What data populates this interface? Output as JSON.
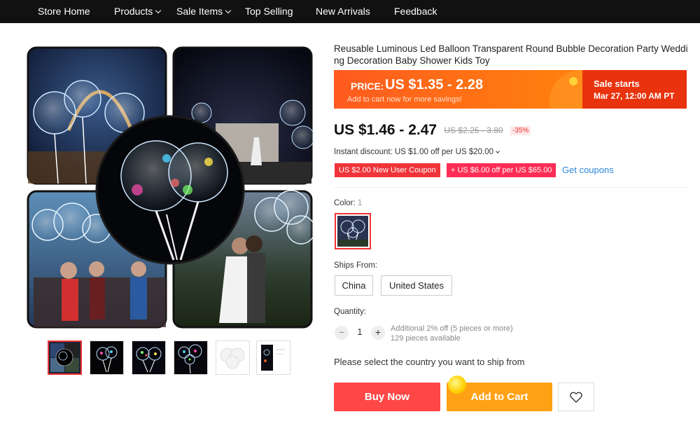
{
  "nav": {
    "items": [
      {
        "label": "Store Home"
      },
      {
        "label": "Products"
      },
      {
        "label": "Sale Items"
      },
      {
        "label": "Top Selling"
      },
      {
        "label": "New Arrivals"
      },
      {
        "label": "Feedback"
      }
    ]
  },
  "product": {
    "title_line1": "Reusable Luminous Led Balloon Transparent Round Bubble Decoration Party Weddi",
    "title_line2": "ng Decoration Baby Shower Kids Toy"
  },
  "banner": {
    "price_label": "PRICE:",
    "price_value": "US $1.35 - 2.28",
    "sub": "Add to cart now for more savings!",
    "sale_title": "Sale starts",
    "sale_date": "Mar 27, 12:00 AM PT"
  },
  "price": {
    "current": "US $1.46 - 2.47",
    "original": "US $2.25 - 3.80",
    "discount": "-35%"
  },
  "instant_discount": "Instant discount: US $1.00 off per US $20.00",
  "coupons": {
    "new_user": "US $2.00 New User Coupon",
    "store": "+ US $6.00 off per US $65.00",
    "get_link": "Get coupons"
  },
  "color": {
    "label": "Color:",
    "selected_count": "1"
  },
  "ships_from": {
    "label": "Ships From:",
    "options": [
      "China",
      "United States"
    ]
  },
  "quantity": {
    "label": "Quantity:",
    "minus": "−",
    "value": "1",
    "plus": "+",
    "note_line1": "Additional 2% off (5 pieces or more)",
    "note_line2": "129 pieces available"
  },
  "ship_notice": "Please select the country you want to ship from",
  "actions": {
    "buy_now": "Buy Now",
    "add_to_cart": "Add to Cart"
  },
  "colors": {
    "nav_bg": "#111111",
    "accent_red": "#ff4747",
    "accent_orange": "#ffa114",
    "banner_orange": "#ff6a14",
    "coupon_red": "#f0353a",
    "link_blue": "#2e87d9"
  },
  "icons": {
    "nav_dropdown": "chevron-down-icon",
    "wishlist": "heart-icon",
    "instant_dropdown": "chevron-down-icon"
  }
}
